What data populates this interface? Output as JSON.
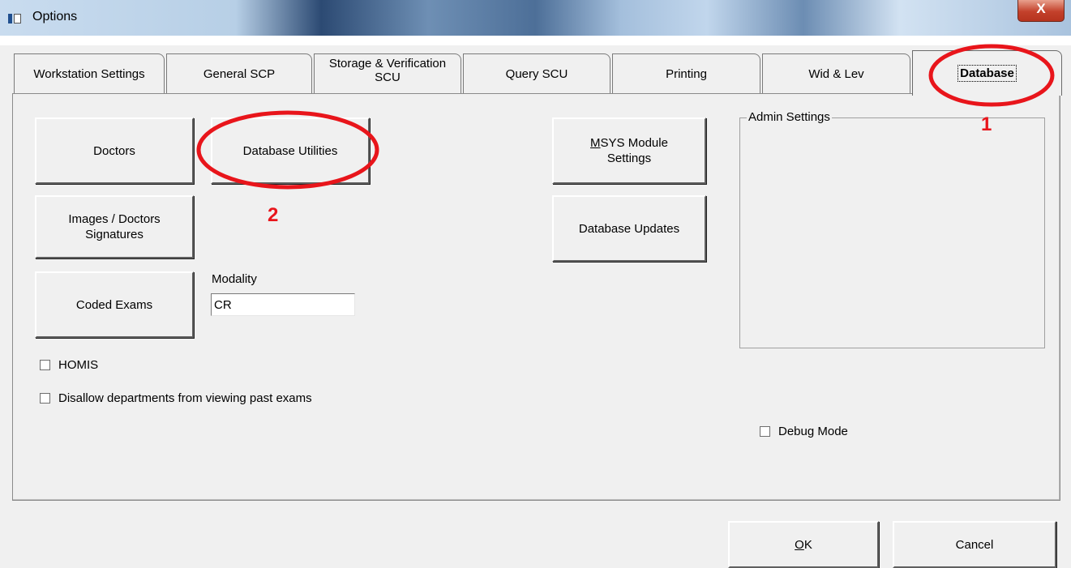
{
  "window": {
    "title": "Options",
    "close_glyph": "X"
  },
  "tabs": [
    {
      "label": "Workstation Settings"
    },
    {
      "label": "General SCP"
    },
    {
      "label": "Storage & Verification SCU"
    },
    {
      "label": "Query SCU"
    },
    {
      "label": "Printing"
    },
    {
      "label": "Wid & Lev"
    },
    {
      "label": "Database",
      "active": true
    }
  ],
  "database_tab": {
    "buttons": {
      "doctors": "Doctors",
      "database_utilities": "Database Utilities",
      "images_signatures_line1": "Images / Doctors",
      "images_signatures_line2": "Signatures",
      "coded_exams": "Coded Exams",
      "msys_module_settings_mnemonic": "M",
      "msys_module_settings_line1_rest": "SYS Module",
      "msys_module_settings_line2": "Settings",
      "database_updates": "Database Updates"
    },
    "modality": {
      "label": "Modality",
      "value": "CR"
    },
    "checkboxes": {
      "homis": {
        "label": "HOMIS",
        "checked": false
      },
      "disallow_departments": {
        "label": "Disallow departments from viewing past exams",
        "checked": false
      },
      "debug_mode": {
        "label": "Debug Mode",
        "checked": false
      }
    },
    "admin_settings": {
      "title": "Admin Settings"
    }
  },
  "dialog_buttons": {
    "ok_mnemonic": "O",
    "ok_rest": "K",
    "cancel": "Cancel"
  },
  "annotations": {
    "marker_1": "1",
    "marker_2": "2",
    "color": "#e8151b"
  }
}
